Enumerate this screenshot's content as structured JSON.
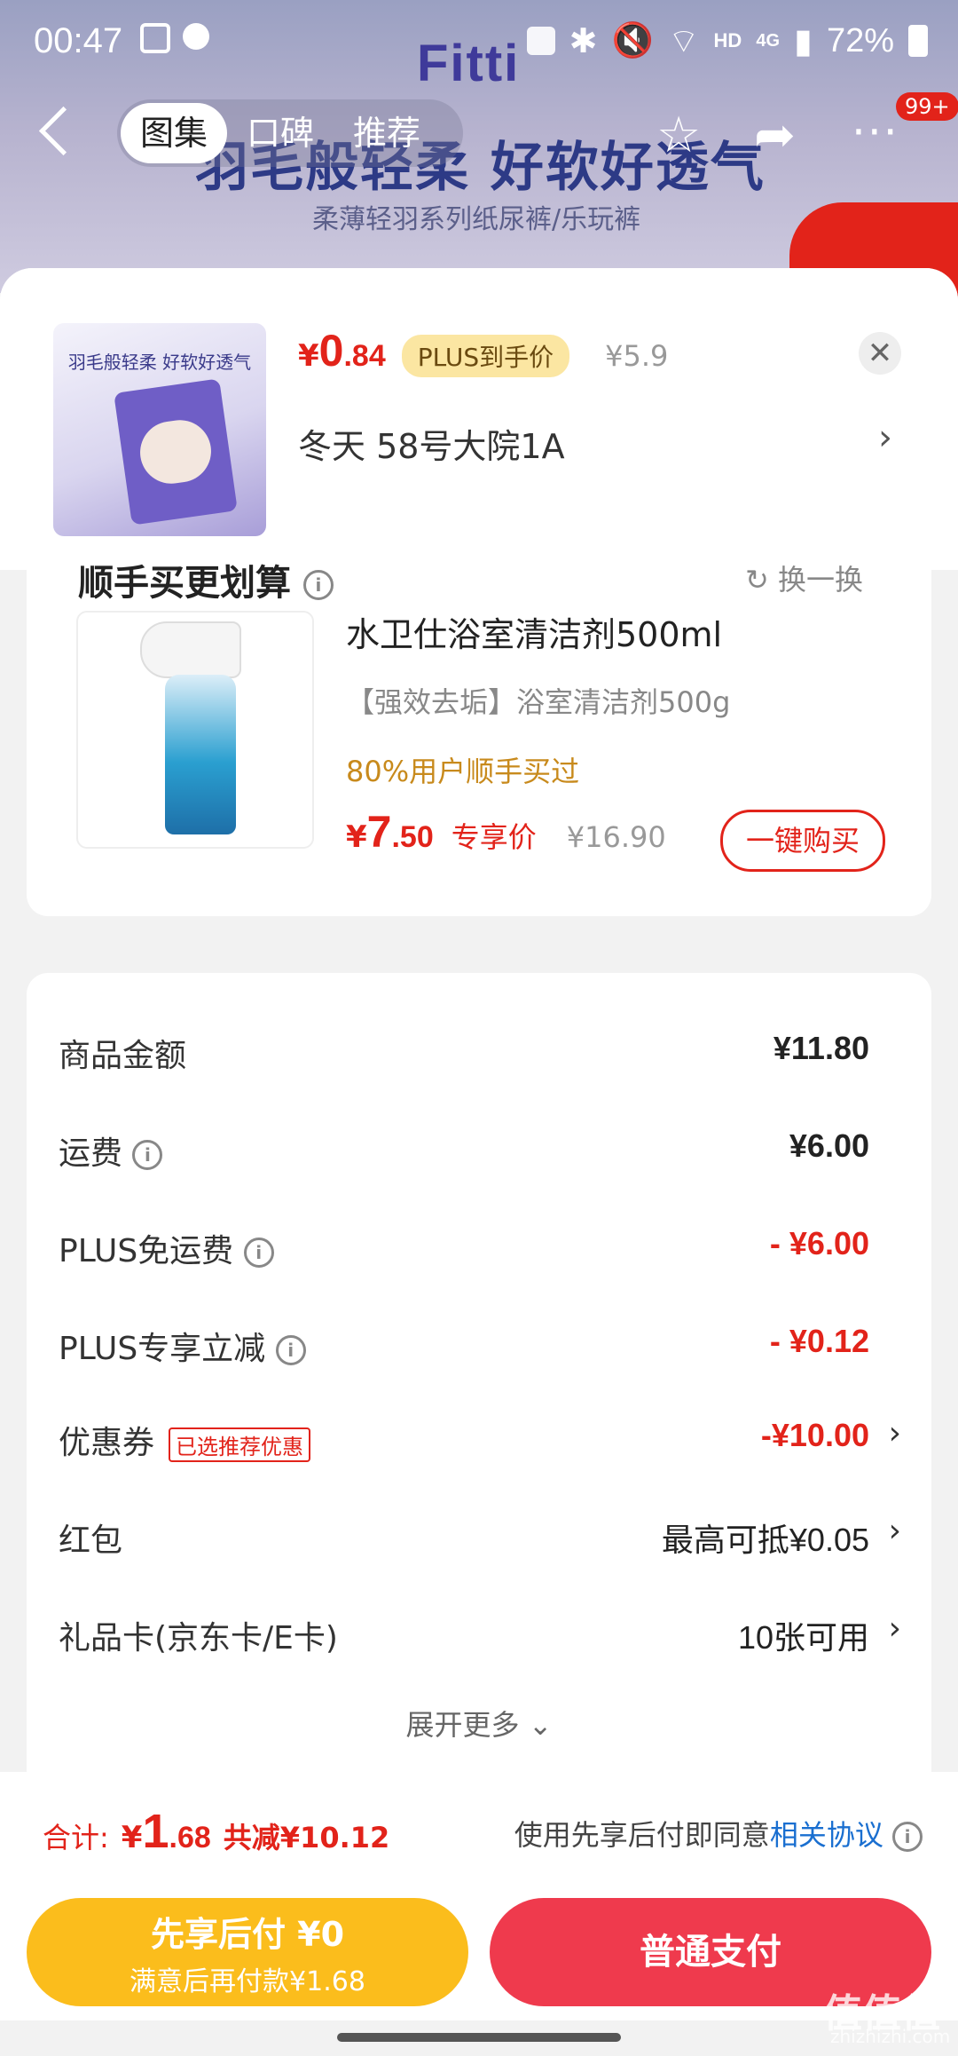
{
  "status_bar": {
    "time": "00:47",
    "battery": "72%",
    "network_label": "HD",
    "network_type": "4G"
  },
  "background_page": {
    "brand": "Fitti",
    "banner_title": "羽毛般轻柔 好软好透气",
    "banner_subtitle": "柔薄轻羽系列纸尿裤/乐玩裤",
    "tabs": [
      "图集",
      "口碑",
      "推荐"
    ],
    "cart_badge": "99+"
  },
  "sheet": {
    "product": {
      "price_yen": "¥",
      "price_int": "0",
      "price_dec": ".84",
      "plus_tag": "PLUS到手价",
      "original_price": "¥5.9",
      "image_caption": "羽毛般轻柔 好软好透气"
    },
    "address": "冬天  58号大院1A",
    "addon": {
      "title": "顺手买更划算",
      "swap_label": "换一换",
      "name": "水卫仕浴室清洁剂500ml",
      "desc": "【强效去垢】浴室清洁剂500g",
      "hint": "80%用户顺手买过",
      "price_yen": "¥",
      "price_int": "7",
      "price_dec": ".50",
      "exclusive_label": "专享价",
      "original_price": "¥16.90",
      "buy_button": "一键购买"
    },
    "summary": {
      "rows": [
        {
          "label": "商品金额",
          "value": "¥11.80"
        },
        {
          "label": "运费",
          "value": "¥6.00"
        },
        {
          "label": "PLUS免运费",
          "value": "- ¥6.00"
        },
        {
          "label": "PLUS专享立减",
          "value": "- ¥0.12"
        },
        {
          "label": "优惠券",
          "tag": "已选推荐优惠",
          "value": "-¥10.00"
        },
        {
          "label": "红包",
          "value": "最高可抵¥0.05"
        },
        {
          "label": "礼品卡(京东卡/E卡)",
          "value": "10张可用"
        }
      ],
      "expand_label": "展开更多"
    }
  },
  "totals": {
    "label": "合计:",
    "yen": "¥",
    "int": "1",
    "dec": ".68",
    "saved": "共减¥10.12",
    "agreement_prefix": "使用先享后付即同意",
    "agreement_link": "相关协议"
  },
  "buttons": {
    "pay_later_title": "先享后付 ¥0",
    "pay_later_sub": "满意后再付款¥1.68",
    "pay_normal": "普通支付"
  },
  "watermark": {
    "main": "值值值",
    "sub": "zhizhizhi.com"
  },
  "colors": {
    "accent_red": "#e2231a",
    "pay_later_yellow": "#fbbd1c",
    "pay_button": "#ef3a4d",
    "link_blue": "#1a6fd0"
  }
}
